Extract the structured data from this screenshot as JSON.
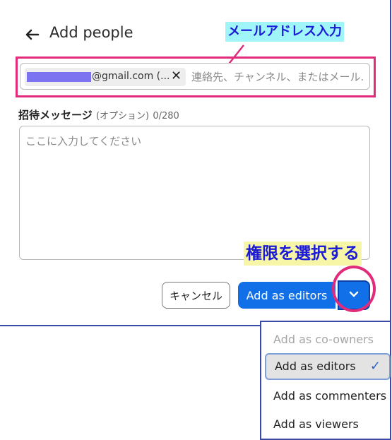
{
  "dialog": {
    "title": "Add people",
    "recipient": {
      "chip_text": "@gmail.com (...",
      "placeholder": "連絡先、チャンネル、またはメール..."
    },
    "message": {
      "label": "招待メッセージ",
      "optional": "(オプション)",
      "count": "0/280",
      "placeholder": "ここに入力してください"
    },
    "buttons": {
      "cancel": "キャンセル",
      "primary": "Add as editors"
    }
  },
  "annotations": {
    "email_callout": "メールアドレス入力",
    "permission_callout": "権限を選択する"
  },
  "menu": {
    "items": [
      {
        "label": "Add as co-owners",
        "state": "disabled"
      },
      {
        "label": "Add as editors",
        "state": "selected"
      },
      {
        "label": "Add as commenters",
        "state": "normal"
      },
      {
        "label": "Add as viewers",
        "state": "normal"
      }
    ]
  },
  "colors": {
    "primary": "#1170e8",
    "highlight": "#e02c7a",
    "callout_text": "#1a1ad8",
    "redaction": "#7b73ef"
  }
}
